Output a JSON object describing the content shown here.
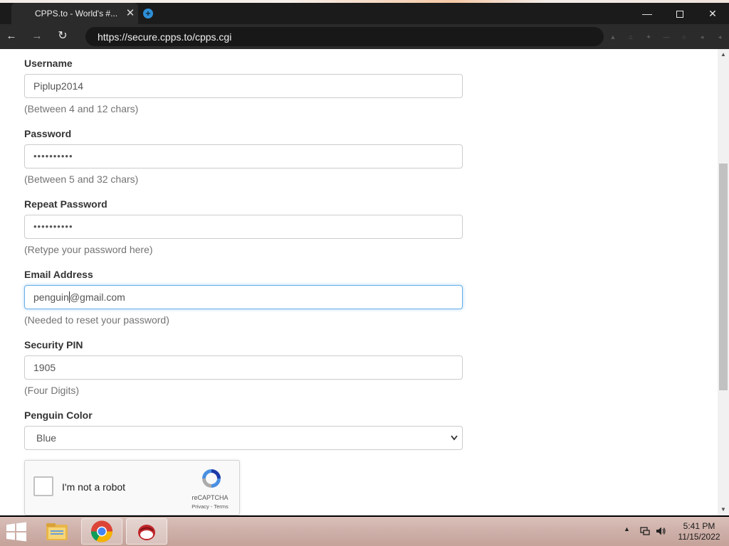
{
  "browser": {
    "tab_title": "CPPS.to - World's #...",
    "tab_close": "✕",
    "new_tab": "+",
    "url": "https://secure.cpps.to/cpps.cgi",
    "window_controls": {
      "minimize": "—",
      "close": "✕"
    },
    "nav": {
      "back": "←",
      "forward": "→",
      "reload": "↻"
    }
  },
  "form": {
    "username": {
      "label": "Username",
      "value": "Piplup2014",
      "help": "(Between 4 and 12 chars)"
    },
    "password": {
      "label": "Password",
      "value": "••••••••••",
      "help": "(Between 5 and 32 chars)"
    },
    "repeat_password": {
      "label": "Repeat Password",
      "value": "••••••••••",
      "help": "(Retype your password here)"
    },
    "email": {
      "label": "Email Address",
      "value_before_caret": "penguin",
      "value_after_caret": "@gmail.com",
      "help": "(Needed to reset your password)"
    },
    "security_pin": {
      "label": "Security PIN",
      "value": "1905",
      "help": "(Four Digits)"
    },
    "penguin_color": {
      "label": "Penguin Color",
      "selected": "Blue"
    }
  },
  "captcha": {
    "label": "I'm not a robot",
    "brand": "reCAPTCHA",
    "links": "Privacy - Terms"
  },
  "taskbar": {
    "time": "5:41 PM",
    "date": "11/15/2022"
  },
  "colors": {
    "chrome_dark": "#2b2b2b",
    "tabbar": "#1b1b1b",
    "focus_border": "#66afe9",
    "label_text": "#333333",
    "help_text": "#737373"
  },
  "icons": [
    "chrome-tab-favicon",
    "close-icon",
    "new-tab-icon",
    "back-icon",
    "forward-icon",
    "reload-icon",
    "minimize-icon",
    "maximize-icon",
    "window-close-icon",
    "chevron-down-icon",
    "recaptcha-logo-icon",
    "windows-start-icon",
    "file-explorer-icon",
    "chrome-icon",
    "game-app-icon",
    "network-icon",
    "volume-icon"
  ]
}
